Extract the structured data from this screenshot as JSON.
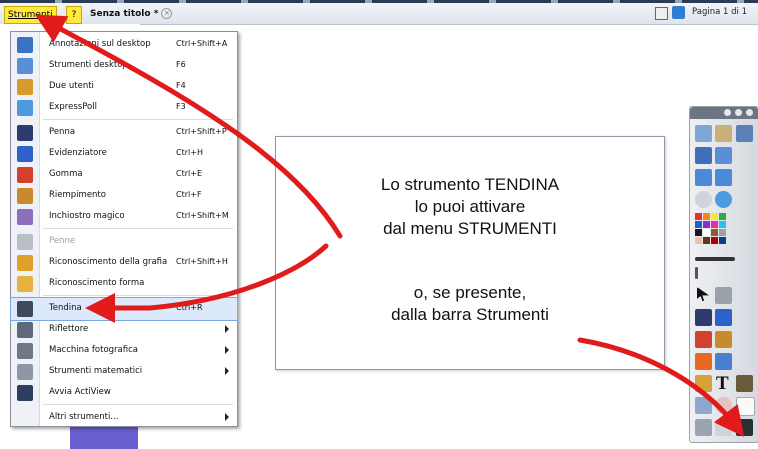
{
  "tabbar": {
    "menu_label": "Strumenti",
    "help_label": "?",
    "doc_title": "Senza titolo *",
    "doc_close": "×",
    "page_label": "Pagina 1 di 1"
  },
  "menu": {
    "items": [
      {
        "label": "Annotazioni sul desktop",
        "shortcut": "Ctrl+Shift+A",
        "icon": "desktop-annotation-icon",
        "color": "#3a72c6"
      },
      {
        "label": "Strumenti desktop",
        "shortcut": "F6",
        "icon": "desktop-tools-icon",
        "color": "#5a8fd8"
      },
      {
        "label": "Due utenti",
        "shortcut": "F4",
        "icon": "dual-user-icon",
        "color": "#d89a2c"
      },
      {
        "label": "ExpressPoll",
        "shortcut": "F3",
        "icon": "expresspoll-icon",
        "color": "#4d9ae0"
      },
      {
        "label": "Penna",
        "shortcut": "Ctrl+Shift+P",
        "icon": "pen-icon",
        "color": "#2e3b6e"
      },
      {
        "label": "Evidenziatore",
        "shortcut": "Ctrl+H",
        "icon": "highlighter-icon",
        "color": "#2d62c9"
      },
      {
        "label": "Gomma",
        "shortcut": "Ctrl+E",
        "icon": "eraser-icon",
        "color": "#d3412c"
      },
      {
        "label": "Riempimento",
        "shortcut": "Ctrl+F",
        "icon": "fill-icon",
        "color": "#c88a2a"
      },
      {
        "label": "Inchiostro magico",
        "shortcut": "Ctrl+Shift+M",
        "icon": "magic-ink-icon",
        "color": "#8c6fbf"
      },
      {
        "label": "Penne",
        "shortcut": "",
        "icon": "pens-icon",
        "color": "#b9bec6",
        "disabled": true
      },
      {
        "label": "Riconoscimento della grafia",
        "shortcut": "Ctrl+Shift+H",
        "icon": "handwriting-recognition-icon",
        "color": "#e0a12c"
      },
      {
        "label": "Riconoscimento forma",
        "shortcut": "",
        "icon": "shape-recognition-icon",
        "color": "#e8b33c"
      },
      {
        "label": "Tendina",
        "shortcut": "Ctrl+R",
        "icon": "screen-shade-icon",
        "color": "#3f4a5c",
        "selected": true
      },
      {
        "label": "Riflettore",
        "shortcut": "",
        "icon": "spotlight-icon",
        "color": "#5f6b7c",
        "submenu": true
      },
      {
        "label": "Macchina fotografica",
        "shortcut": "",
        "icon": "camera-icon",
        "color": "#6f7886",
        "submenu": true
      },
      {
        "label": "Strumenti matematici",
        "shortcut": "",
        "icon": "math-tools-icon",
        "color": "#8d97a5",
        "submenu": true
      },
      {
        "label": "Avvia ActiView",
        "shortcut": "",
        "icon": "actiview-icon",
        "color": "#2c3d5e"
      },
      {
        "label": "Altri strumenti...",
        "shortcut": "",
        "icon": "",
        "color": "",
        "submenu": true
      }
    ]
  },
  "note": {
    "line1": "Lo strumento TENDINA",
    "line2": "lo puoi attivare",
    "line3": "dal menu STRUMENTI",
    "line4": "o, se presente,",
    "line5": "dalla barra Strumenti"
  },
  "toolbar": {
    "palette": [
      "#e8312a",
      "#f28a1e",
      "#f5e62a",
      "#2ea94b",
      "#1c5fd6",
      "#8b2fc9",
      "#e62ca8",
      "#23c6e0",
      "#1a1a1a",
      "#ffffff",
      "#8c5a2b",
      "#a1a1a1",
      "#f3c1a1",
      "#5b3a1e",
      "#b00000",
      "#0b3d91"
    ],
    "text_tool": "T"
  },
  "colors": {
    "accent_yellow": "#ffe93c",
    "annotation_arrow": "#e11b1b",
    "selected_bg": "#dce9fb"
  }
}
